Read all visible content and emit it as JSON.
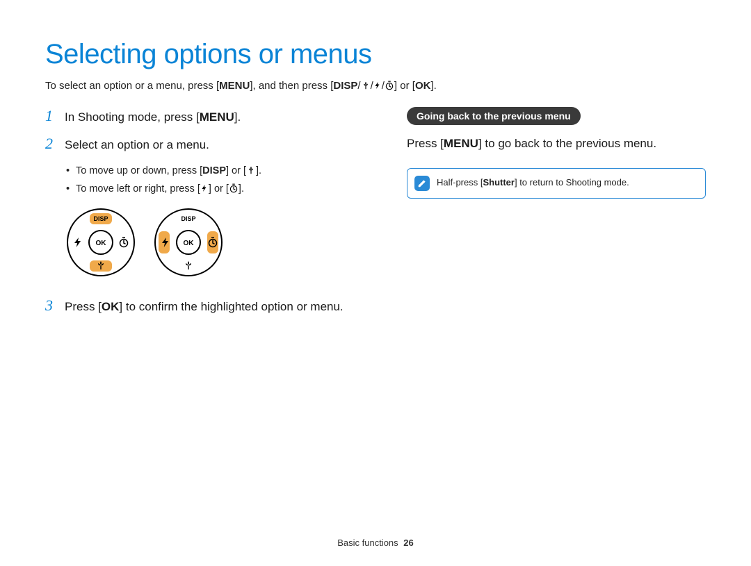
{
  "title": "Selecting options or menus",
  "intro": {
    "pre": "To select an option or a menu, press [",
    "menu": "MENU",
    "mid1": "], and then press [",
    "disp": "DISP",
    "slash": "/",
    "mid2": "] or [",
    "ok": "OK",
    "post": "]."
  },
  "steps": {
    "s1": {
      "num": "1",
      "pre": "In Shooting mode, press [",
      "menu": "MENU",
      "post": "]."
    },
    "s2": {
      "num": "2",
      "text": "Select an option or a menu.",
      "b1": {
        "pre": "To move up or down, press [",
        "disp": "DISP",
        "mid": "] or [",
        "post": "]."
      },
      "b2": {
        "pre": "To move left or right, press [",
        "mid": "] or [",
        "post": "]."
      }
    },
    "s3": {
      "num": "3",
      "pre": "Press [",
      "ok": "OK",
      "post": "] to confirm the highlighted option or menu."
    }
  },
  "dial": {
    "disp": "DISP",
    "ok": "OK"
  },
  "right": {
    "pill": "Going back to the previous menu",
    "text": {
      "pre": "Press [",
      "menu": "MENU",
      "post": "] to go back to the previous menu."
    },
    "note": {
      "pre": "Half-press [",
      "shutter": "Shutter",
      "post": "] to return to Shooting mode."
    }
  },
  "footer": {
    "section": "Basic functions",
    "page": "26"
  }
}
